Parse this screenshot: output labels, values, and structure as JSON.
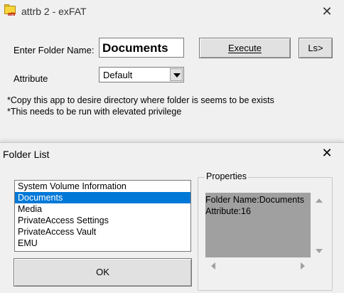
{
  "main_window": {
    "title": "attrb 2 - exFAT",
    "icon_tag": "attr",
    "folder_label": "Enter Folder Name:",
    "folder_value": "Documents",
    "execute_label": "Execute",
    "ls_label": "Ls>",
    "attribute_label": "Attribute",
    "attribute_value": "Default",
    "notes": [
      "*Copy this app to desire directory where folder is seems to be exists",
      "*This needs to be run with elevated privilege"
    ]
  },
  "dialog": {
    "title": "Folder List",
    "items": [
      "System Volume Information",
      "Documents",
      "Media",
      "PrivateAccess Settings",
      "PrivateAccess Vault",
      "EMU"
    ],
    "ok_label": "OK",
    "properties_title": "Properties",
    "properties_lines": [
      "Folder Name:Documents",
      "Attribute:16"
    ]
  },
  "colors": {
    "selection": "#0078d7",
    "properties_bg": "#a0a0a0",
    "window_bg": "#f0f0f0"
  }
}
